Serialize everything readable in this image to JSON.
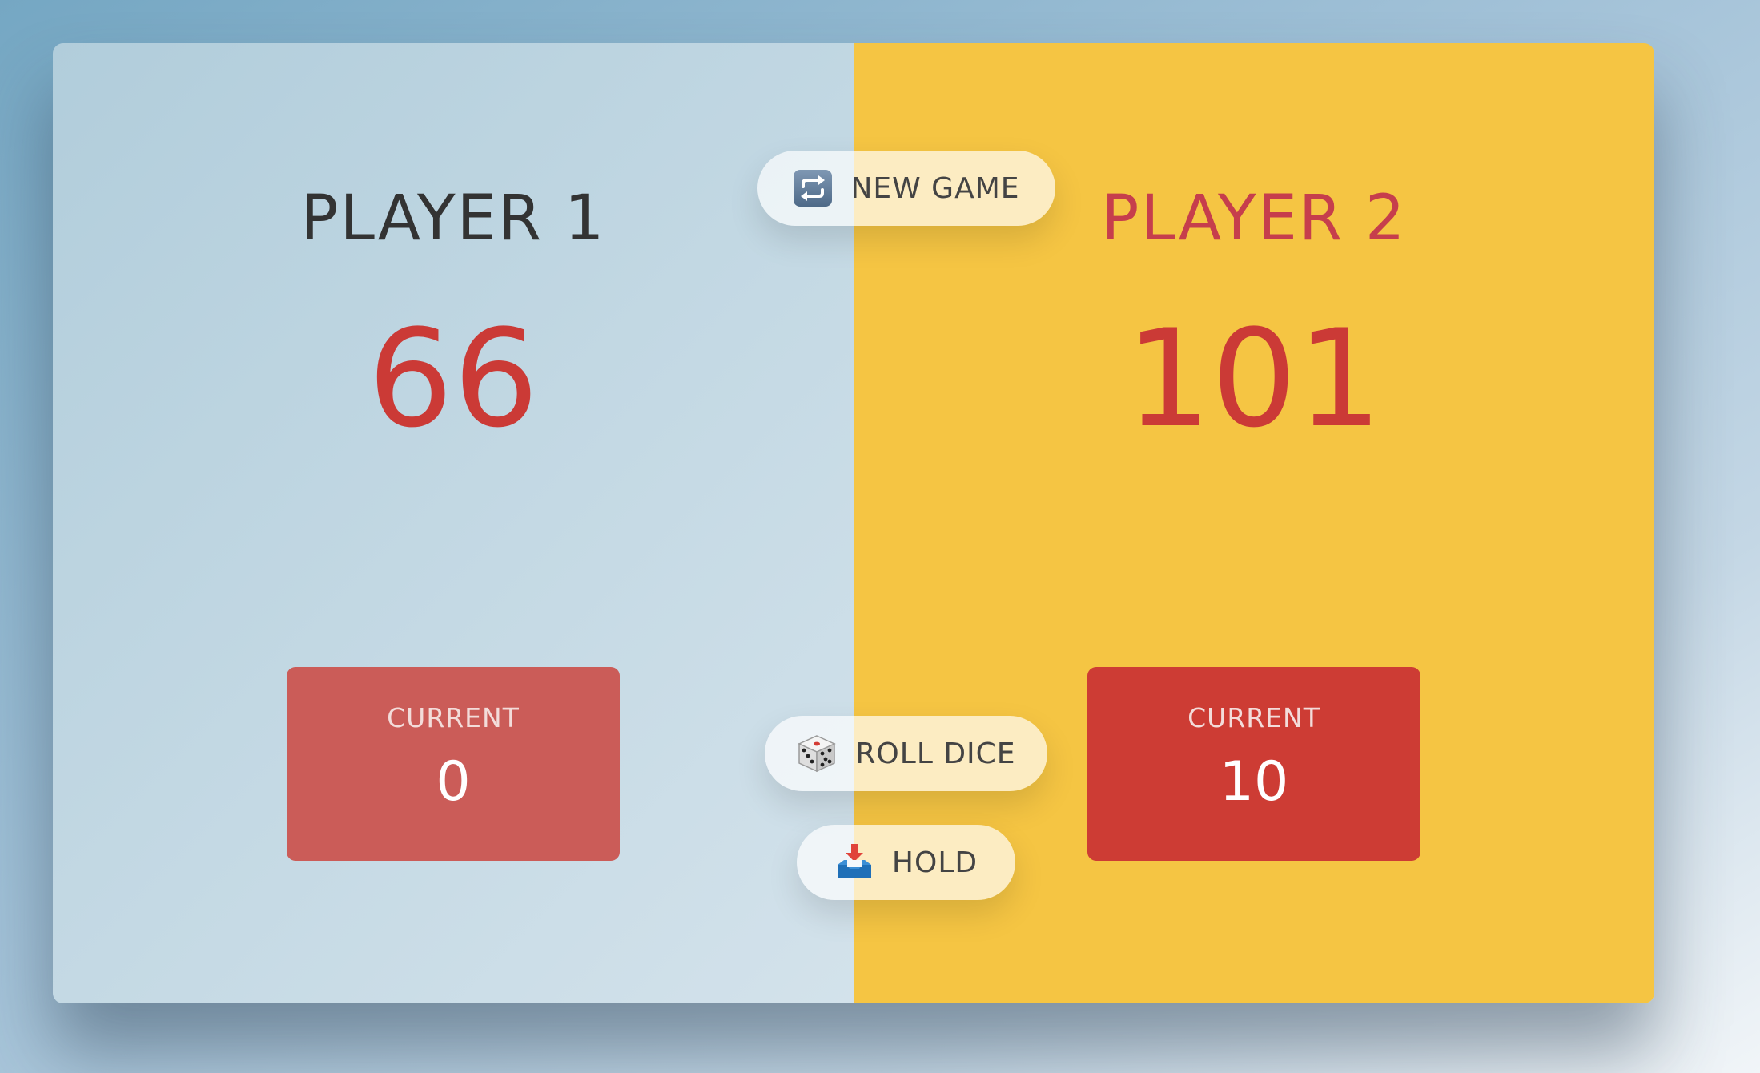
{
  "buttons": {
    "new_game": {
      "label": "NEW GAME",
      "icon": "repeat-icon"
    },
    "roll_dice": {
      "label": "ROLL DICE",
      "icon": "dice-icon"
    },
    "hold": {
      "label": "HOLD",
      "icon": "inbox-tray-icon"
    }
  },
  "players": [
    {
      "name": "PLAYER 1",
      "score": "66",
      "current_label": "CURRENT",
      "current_score": "0",
      "active": false
    },
    {
      "name": "PLAYER 2",
      "score": "101",
      "current_label": "CURRENT",
      "current_score": "10",
      "active": true
    }
  ],
  "colors": {
    "score_red": "#cb3a36",
    "player2_name": "#c63e4c",
    "player2_panel": "#f5c543",
    "current_box_1": "#cb5c58",
    "current_box_2": "#cd3c34"
  }
}
